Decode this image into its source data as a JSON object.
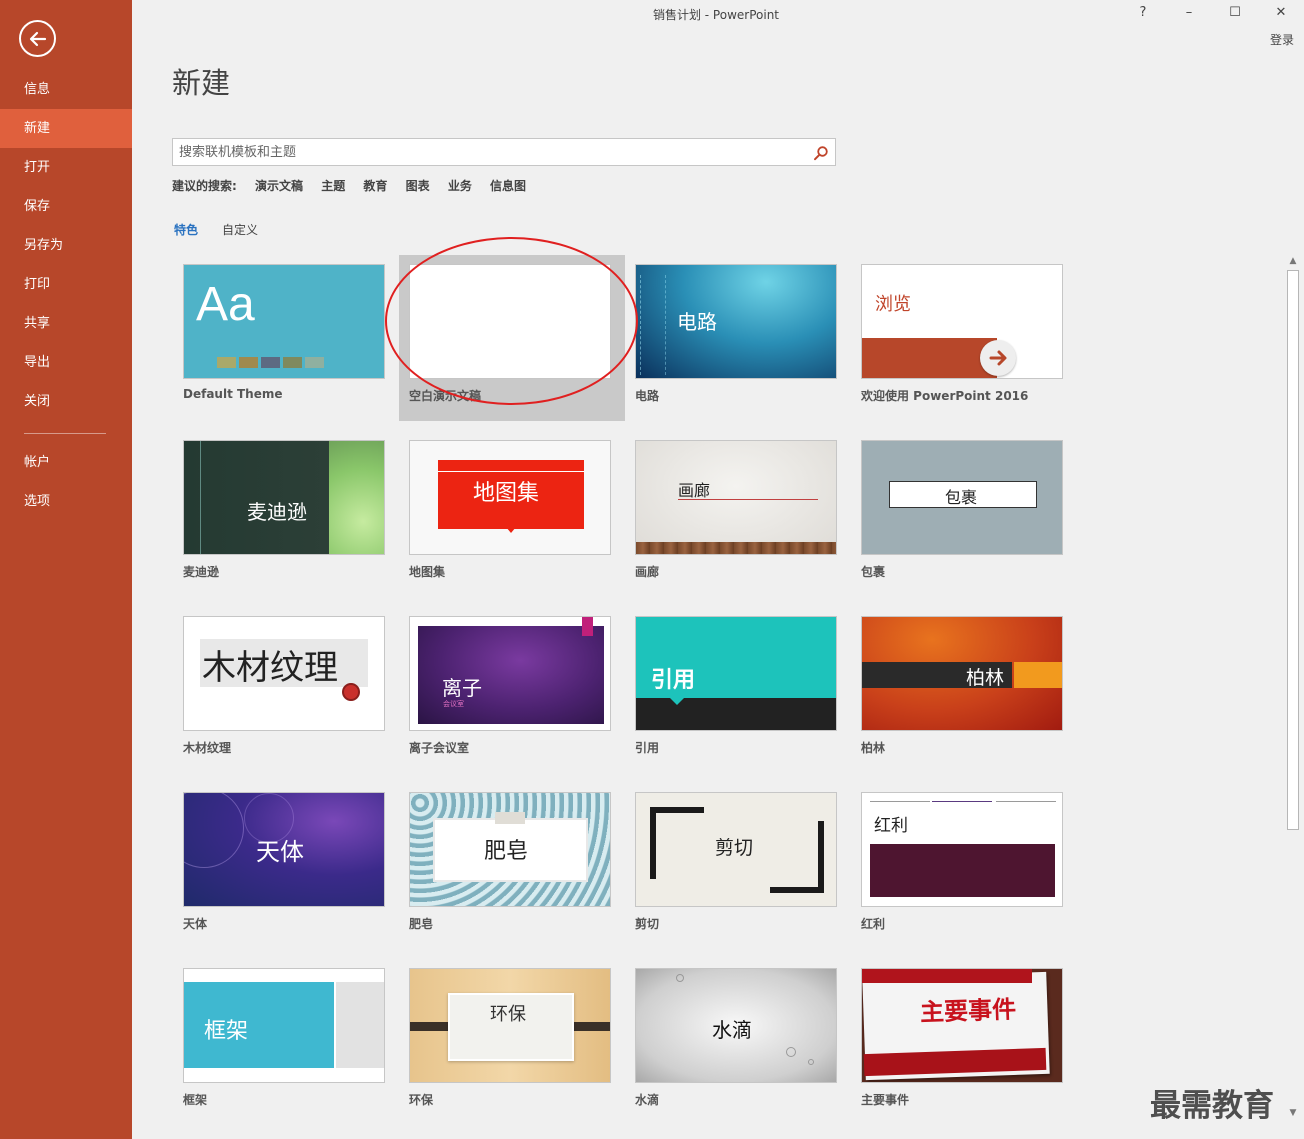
{
  "window": {
    "title": "销售计划 - PowerPoint",
    "help": "?",
    "minimize": "–",
    "maximize": "☐",
    "close": "✕",
    "signin": "登录"
  },
  "sidebar": {
    "items": [
      {
        "label": "信息"
      },
      {
        "label": "新建"
      },
      {
        "label": "打开"
      },
      {
        "label": "保存"
      },
      {
        "label": "另存为"
      },
      {
        "label": "打印"
      },
      {
        "label": "共享"
      },
      {
        "label": "导出"
      },
      {
        "label": "关闭"
      },
      {
        "label": "帐户"
      },
      {
        "label": "选项"
      }
    ],
    "active": "新建"
  },
  "main": {
    "title": "新建",
    "search": {
      "placeholder": "搜索联机模板和主题"
    },
    "suggested": {
      "label": "建议的搜索:",
      "links": [
        "演示文稿",
        "主题",
        "教育",
        "图表",
        "业务",
        "信息图"
      ]
    },
    "tabs": [
      {
        "label": "特色"
      },
      {
        "label": "自定义"
      }
    ],
    "templates": [
      {
        "label": "Default Theme",
        "thumb_text": "Aa"
      },
      {
        "label": "空白演示文稿",
        "thumb_text": ""
      },
      {
        "label": "电路",
        "thumb_text": "电路"
      },
      {
        "label": "欢迎使用 PowerPoint 2016",
        "thumb_text": "浏览"
      },
      {
        "label": "麦迪逊",
        "thumb_text": "麦迪逊"
      },
      {
        "label": "地图集",
        "thumb_text": "地图集"
      },
      {
        "label": "画廊",
        "thumb_text": "画廊"
      },
      {
        "label": "包裹",
        "thumb_text": "包裹"
      },
      {
        "label": "木材纹理",
        "thumb_text": "木材纹理"
      },
      {
        "label": "离子会议室",
        "thumb_text": "离子",
        "thumb_sub": "会议室"
      },
      {
        "label": "引用",
        "thumb_text": "引用"
      },
      {
        "label": "柏林",
        "thumb_text": "柏林"
      },
      {
        "label": "天体",
        "thumb_text": "天体"
      },
      {
        "label": "肥皂",
        "thumb_text": "肥皂"
      },
      {
        "label": "剪切",
        "thumb_text": "剪切"
      },
      {
        "label": "红利",
        "thumb_text": "红利"
      },
      {
        "label": "框架",
        "thumb_text": "框架"
      },
      {
        "label": "环保",
        "thumb_text": "环保"
      },
      {
        "label": "水滴",
        "thumb_text": "水滴"
      },
      {
        "label": "主要事件",
        "thumb_text": "主要事件"
      }
    ]
  },
  "watermark": "最需教育",
  "colors": {
    "sidebar": "#b7472a",
    "sidebar_active": "#e0603d",
    "accent_link": "#2a72c0"
  }
}
